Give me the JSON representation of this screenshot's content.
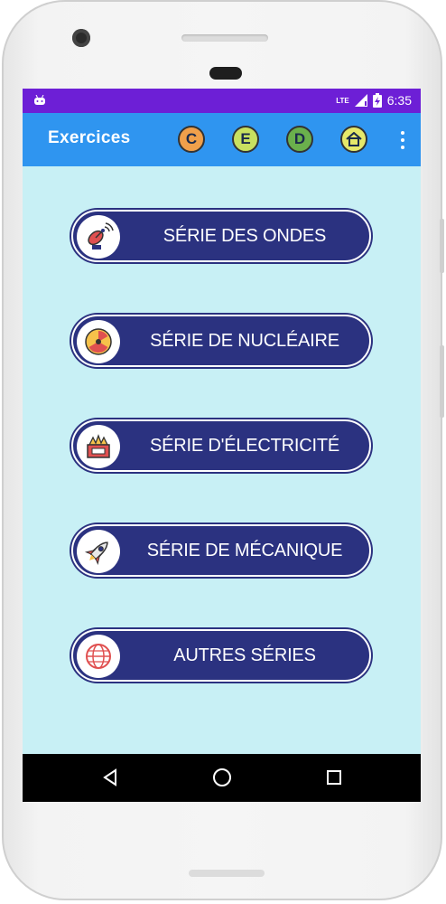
{
  "status_bar": {
    "network": "LTE",
    "time": "6:35"
  },
  "app_bar": {
    "title": "Exercices",
    "icons": [
      {
        "name": "c-letter-icon",
        "letter": "C",
        "color": "#f0a04b"
      },
      {
        "name": "e-letter-icon",
        "letter": "E",
        "color": "#c8e060"
      },
      {
        "name": "d-letter-icon",
        "letter": "D",
        "color": "#6ab04c"
      },
      {
        "name": "home-icon",
        "letter": "",
        "color": "#e6e86a"
      }
    ],
    "menu_icon": "more-vert-icon"
  },
  "series": [
    {
      "label": "SÉRIE DES ONDES",
      "icon": "satellite-dish-icon"
    },
    {
      "label": "SÉRIE DE NUCLÉAIRE",
      "icon": "radiation-icon"
    },
    {
      "label": "SÉRIE D'ÉLECTRICITÉ",
      "icon": "electric-generator-icon"
    },
    {
      "label": "SÉRIE DE MÉCANIQUE",
      "icon": "rocket-icon"
    },
    {
      "label": "AUTRES SÉRIES",
      "icon": "globe-icon"
    }
  ],
  "nav_bar": {
    "back": "back-icon",
    "home": "home-circle-icon",
    "recents": "recents-icon"
  },
  "colors": {
    "status_bar": "#6d1fd6",
    "app_bar": "#2f95f0",
    "background": "#c8f0f5",
    "button": "#2b3280"
  }
}
